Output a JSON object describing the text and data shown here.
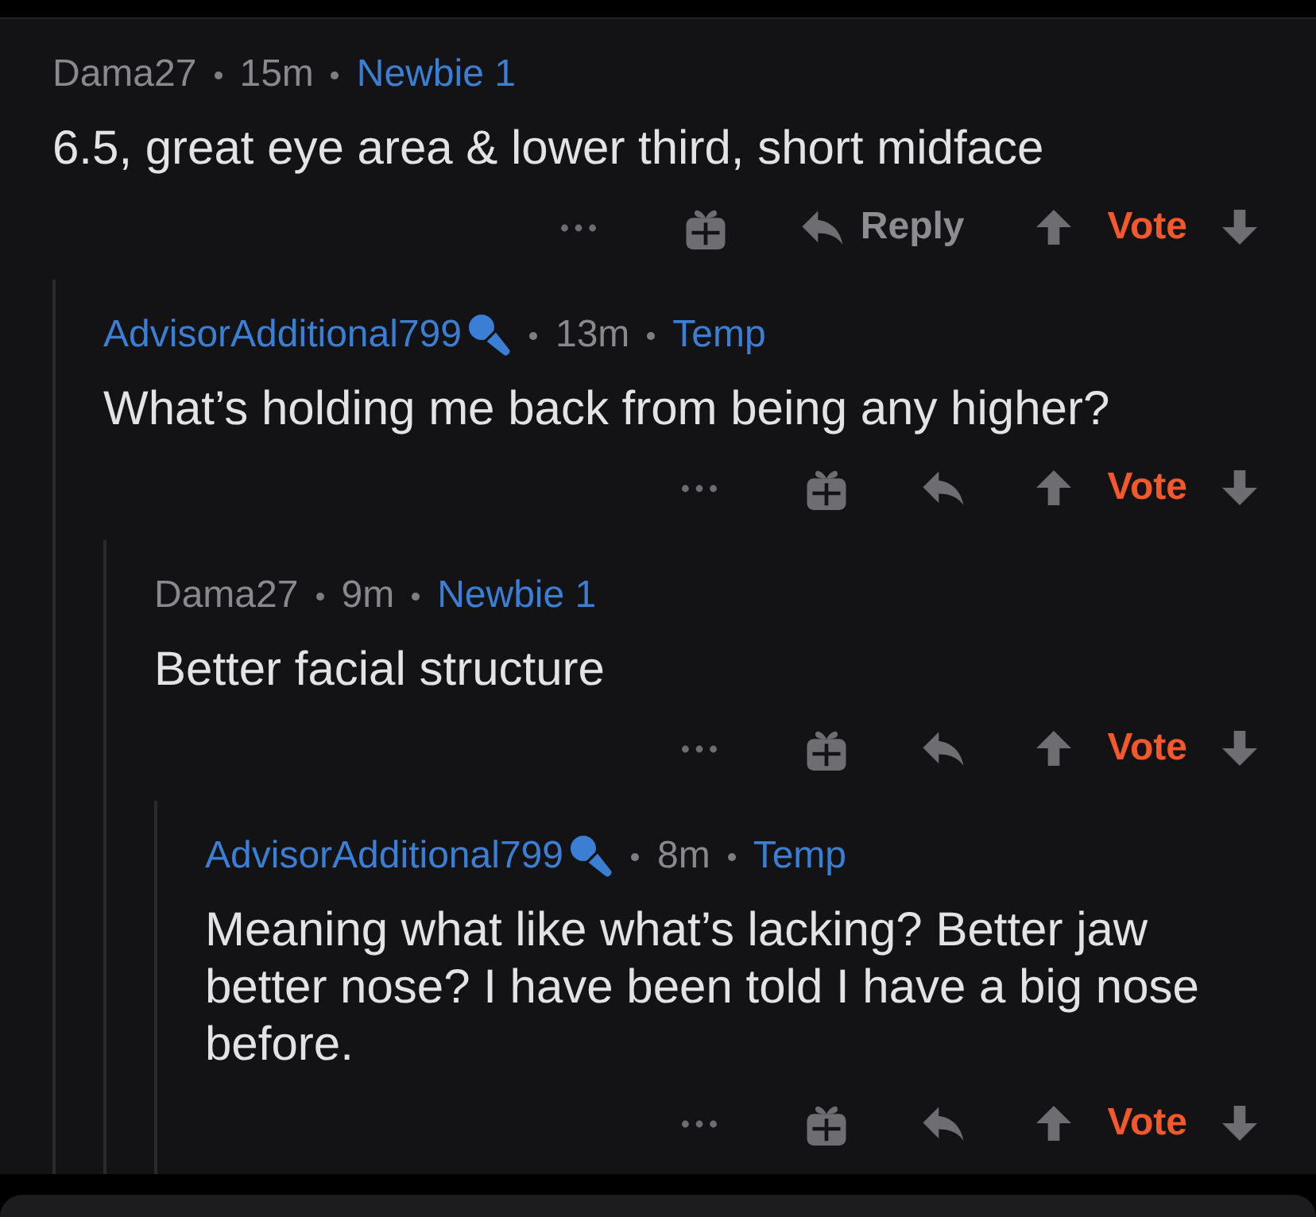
{
  "thread": {
    "comments": [
      {
        "author": "Dama27",
        "op": false,
        "time": "15m",
        "flair": "Newbie 1",
        "body": "6.5, great eye area & lower third, short midface",
        "reply_label": "Reply",
        "vote_label": "Vote",
        "children": [
          {
            "author": "AdvisorAdditional799",
            "op": true,
            "time": "13m",
            "flair": "Temp",
            "body": "What’s holding me back from being any higher?",
            "vote_label": "Vote",
            "children": [
              {
                "author": "Dama27",
                "op": false,
                "time": "9m",
                "flair": "Newbie 1",
                "body": "Better facial structure",
                "vote_label": "Vote",
                "children": [
                  {
                    "author": "AdvisorAdditional799",
                    "op": true,
                    "time": "8m",
                    "flair": "Temp",
                    "body": "Meaning what like what’s lacking? Better jaw better nose? I have been told I have a big nose before.",
                    "vote_label": "Vote"
                  }
                ]
              }
            ]
          }
        ]
      }
    ]
  }
}
